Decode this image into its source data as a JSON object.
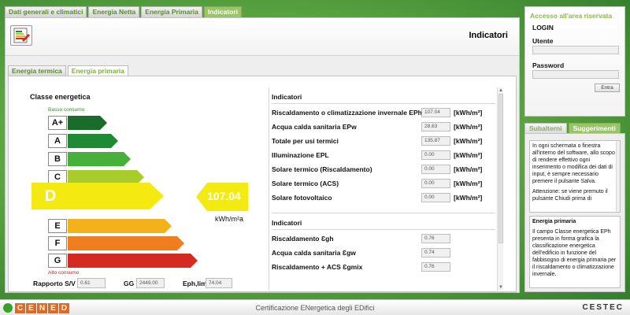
{
  "top_tabs": [
    "Dati generali e climatici",
    "Energia Netta",
    "Energia Primaria",
    "Indicatori"
  ],
  "header": {
    "title": "Indicatori",
    "icon": "certificate-icon"
  },
  "sub_tabs": [
    "Energia termica",
    "Energia primaria"
  ],
  "energy_class": {
    "title": "Classe energetica",
    "low_label": "Basso consumo",
    "high_label": "Alto consumo",
    "classes": [
      "A+",
      "A",
      "B",
      "C",
      "D",
      "E",
      "F",
      "G"
    ],
    "colors": [
      "#1b6b2a",
      "#1f8a34",
      "#46b03a",
      "#a8cc2a",
      "#f4ea12",
      "#f3b21a",
      "#ee7e1e",
      "#d42a22"
    ],
    "selected": "D",
    "value": "107.04",
    "unit": "kWh/m²a"
  },
  "footer": {
    "rapporto_label": "Rapporto S/V",
    "rapporto_value": "0.61",
    "gg_label": "GG",
    "gg_value": "2449.00",
    "eph_label": "Eph,lim",
    "eph_value": "74.04"
  },
  "indicators": {
    "title": "Indicatori",
    "unit": "[kWh/m²]",
    "rows": [
      {
        "label": "Riscaldamento o climatizzazione invernale EPh",
        "value": "107.04"
      },
      {
        "label": "Acqua calda sanitaria EPw",
        "value": "28.83"
      },
      {
        "label": "Totale per usi termici",
        "value": "135.87"
      },
      {
        "label": "Illuminazione EPL",
        "value": "0.00"
      },
      {
        "label": "Solare termico (Riscaldamento)",
        "value": "0.00"
      },
      {
        "label": "Solare termico (ACS)",
        "value": "0.00"
      },
      {
        "label": "Solare fotovoltaico",
        "value": "0.00"
      }
    ]
  },
  "indicators2": {
    "title": "Indicatori",
    "rows": [
      {
        "label": "Riscaldamento Ɛgh",
        "value": "0.76"
      },
      {
        "label": "Acqua calda sanitaria Ɛgw",
        "value": "0.74"
      },
      {
        "label": "Riscaldamento + ACS Ɛgmix",
        "value": "0.76"
      }
    ]
  },
  "login": {
    "title": "Accesso all'area riservata",
    "subtitle": "LOGIN",
    "user_label": "Utente",
    "password_label": "Password",
    "button": "Entra"
  },
  "right_tabs": [
    "Subalterni",
    "Suggerimenti"
  ],
  "suggestions": {
    "box1_text": "In ogni schermata o finestra all'interno del software, allo scopo di rendere effettivo ogni inserimento o modifica dei dati di input, è sempre necessario premere il pulsante Salva.",
    "box1_text2": "Attenzione: se viene premuto il pulsante Chiudi prima di",
    "box2_title": "Energia primaria",
    "box2_text": "Il campo Classe energetica EPh presenta in forma grafica la classificazione energetica dell'edificio in funzione del fabbisogno di energia primaria per il riscaldamento o climatizzazione invernale."
  },
  "bottom": {
    "logo_letters": [
      "C",
      "E",
      "N",
      "E",
      "D"
    ],
    "center_text": "Certificazione ENergetica degli EDifici",
    "right_logo": "CESTEC"
  }
}
